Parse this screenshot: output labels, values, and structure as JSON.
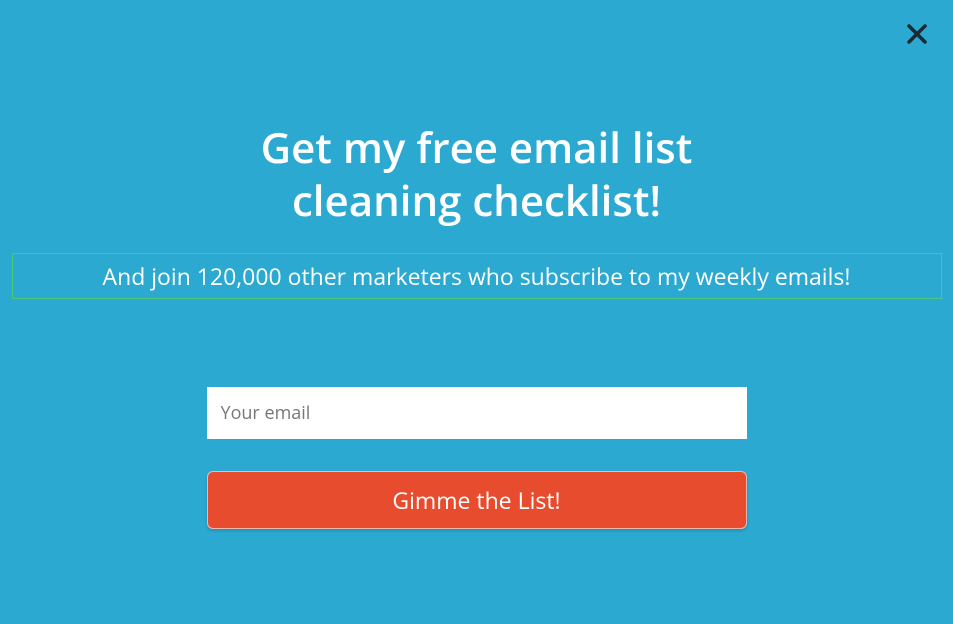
{
  "modal": {
    "heading_line1": "Get my free email list",
    "heading_line2": "cleaning checklist!",
    "subheading": "And join 120,000 other marketers who subscribe to my weekly emails!",
    "email_placeholder": "Your email",
    "email_value": "",
    "submit_label": "Gimme the List!"
  }
}
